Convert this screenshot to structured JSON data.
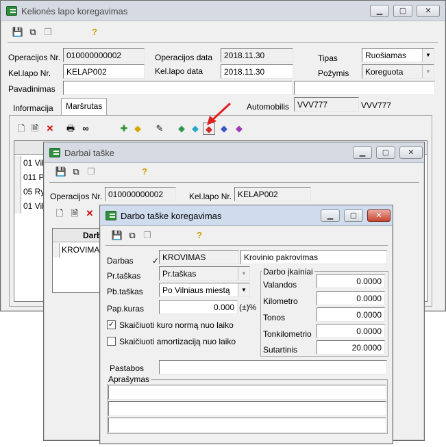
{
  "main_window": {
    "title": "Kelionės lapo koregavimas",
    "toolbar": [
      "save-icon",
      "copy-link-icon",
      "copy-icon",
      "help-icon"
    ],
    "fields": {
      "operacijos_nr_label": "Operacijos Nr.",
      "operacijos_nr": "010000000002",
      "operacijos_data_label": "Operacijos data",
      "operacijos_data": "2018.11.30",
      "tipas_label": "Tipas",
      "tipas": "Ruošiamas",
      "kel_lapo_nr_label": "Kel.lapo Nr.",
      "kel_lapo_nr": "KELAP002",
      "kel_lapo_data_label": "Kel.lapo data",
      "kel_lapo_data": "2018.11.30",
      "pozymis_label": "Požymis",
      "pozymis": "Koreguota",
      "pavadinimas_label": "Pavadinimas",
      "pavadinimas": "",
      "automobilis_label": "Automobilis",
      "automobilis_code": "VVV777",
      "automobilis_name": "VVV777"
    },
    "tabs": [
      "Informacija",
      "Maršrutas"
    ],
    "grid_rows": [
      "01 Vil",
      "011 P",
      "05 Ry",
      "01 Vil"
    ]
  },
  "darbai_window": {
    "title": "Darbai taške",
    "toolbar": [
      "save-icon",
      "copy-link-icon",
      "copy-icon",
      "help-icon"
    ],
    "operacijos_nr_label": "Operacijos Nr.",
    "operacijos_nr": "010000000002",
    "kel_lapo_nr_label": "Kel.lapo Nr.",
    "kel_lapo_nr": "KELAP002",
    "grid_header": "Darb",
    "grid_rows": [
      "KROVIMAS"
    ]
  },
  "darbo_window": {
    "title": "Darbo taške koregavimas",
    "toolbar": [
      "save-icon",
      "copy-link-icon",
      "copy-icon",
      "help-icon"
    ],
    "darbas_label": "Darbas",
    "darbas_code": "KROVIMAS",
    "darbas_name": "Krovinio pakrovimas",
    "pr_taskas_label": "Pr.taškas",
    "pr_taskas": "Pr.taškas",
    "pb_taskas_label": "Pb.taškas",
    "pb_taskas": "Po Vilniaus miestą",
    "pap_kuras_label": "Pap.kuras",
    "pap_kuras": "0.000",
    "pap_kuras_unit": "(±)%",
    "checkbox_kuro_label": "Skaičiuoti kuro normą nuo laiko",
    "checkbox_kuro_checked": true,
    "checkbox_amort_label": "Skaičiuoti amortizaciją nuo laiko",
    "checkbox_amort_checked": false,
    "ikainiai_title": "Darbo įkainiai",
    "ikainiai": [
      {
        "label": "Valandos",
        "value": "0.0000"
      },
      {
        "label": "Kilometro",
        "value": "0.0000"
      },
      {
        "label": "Tonos",
        "value": "0.0000"
      },
      {
        "label": "Tonkilometrio",
        "value": "0.0000"
      },
      {
        "label": "Sutartinis",
        "value": "20.0000"
      }
    ],
    "pastabos_label": "Pastabos",
    "pastabos": "",
    "aprasymas_title": "Aprašymas"
  },
  "colors": {
    "accent_arrow": "#e02020",
    "title_active": "#cfdcee"
  }
}
